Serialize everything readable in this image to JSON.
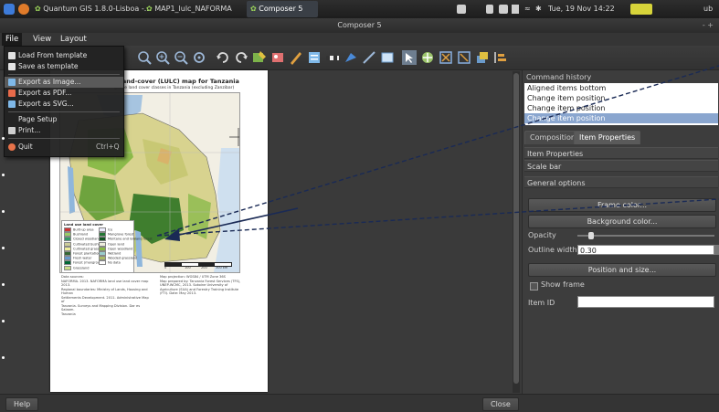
{
  "taskbar": {
    "items": [
      {
        "label": "Quantum GIS 1.8.0-Lisboa -..."
      },
      {
        "label": "MAP1_lulc_NAFORMA"
      },
      {
        "label": "Composer 5"
      }
    ],
    "clock": "Tue, 19 Nov 14:22",
    "user": "ub"
  },
  "window": {
    "title": "Composer 5",
    "controls": "- +"
  },
  "menubar": {
    "items": [
      "File",
      "View",
      "Layout"
    ]
  },
  "file_menu": {
    "items": [
      {
        "label": "Load From template",
        "icon": "folder-icon",
        "color": "#e3e3e3"
      },
      {
        "label": "Save as template",
        "icon": "save-icon",
        "color": "#e3e3e3"
      },
      {
        "label": "Export as Image...",
        "icon": "image-icon",
        "color": "#7fb8e8"
      },
      {
        "label": "Export as PDF...",
        "icon": "pdf-icon",
        "color": "#e86a4a"
      },
      {
        "label": "Export as SVG...",
        "icon": "svg-icon",
        "color": "#7fb8e8"
      },
      {
        "label": "Page Setup",
        "icon": "",
        "color": ""
      },
      {
        "label": "Print...",
        "icon": "printer-icon",
        "color": "#cfcfcf"
      },
      {
        "label": "Quit",
        "shortcut": "Ctrl+Q",
        "icon": "quit-icon",
        "color": "#e8734a"
      }
    ]
  },
  "page": {
    "title": "e land-cover (LULC) map for Tanzania",
    "subtitle": "gative land cover classes in Tanzania (excluding Zanzibar)",
    "legend_title": "Land use land cover",
    "legend": [
      {
        "label": "Built-up area",
        "color": "#c33"
      },
      {
        "label": "Bushland",
        "color": "#9c6"
      },
      {
        "label": "Closed woodland",
        "color": "#396"
      },
      {
        "label": "Cultivated bushland",
        "color": "#cc9"
      },
      {
        "label": "Cultivated grassland",
        "color": "#ee9"
      },
      {
        "label": "Forest plantation",
        "color": "#363"
      },
      {
        "label": "Fresh water",
        "color": "#69c"
      },
      {
        "label": "Forest (mangrove)",
        "color": "#063"
      },
      {
        "label": "Grassland",
        "color": "#cd8"
      },
      {
        "label": "Ice",
        "color": "#eef"
      },
      {
        "label": "Mangrove forest",
        "color": "#273"
      },
      {
        "label": "Montane and lowland forest",
        "color": "#152"
      },
      {
        "label": "Open land",
        "color": "#eed"
      },
      {
        "label": "Open woodland",
        "color": "#8b4"
      },
      {
        "label": "Wetland",
        "color": "#9cc"
      },
      {
        "label": "Wooded grassland",
        "color": "#ab6"
      },
      {
        "label": "No data",
        "color": "#fff"
      }
    ],
    "scale_labels": [
      "0",
      "100",
      "200",
      "300 km"
    ],
    "source_text": "Data sources:\nNAFORMA. 2013. NAFORMA land use land cover map 2013.\nRegional boundaries: Ministry of Lands, Housing and Human\nSettlements Development. 2011. Administrative Map of\nTanzania. Surveys and Mapping Division. Dar es Salaam.\nTanzania",
    "projection_text": "Map projection: WGS84 / UTM Zone 36S\nMap prepared by: Tanzania Forest Services (TFS),\nUNEP-WCMC, 2013. Sokoine University of\nAgriculture (SUA) and Forestry Training Institute\n(FTI). Date: May 2013."
  },
  "right_panel": {
    "history_header": "Command history",
    "history": [
      {
        "label": "Aligned items bottom",
        "selected": false
      },
      {
        "label": "Change item position",
        "selected": false
      },
      {
        "label": "Change item position",
        "selected": false
      },
      {
        "label": "Change item position",
        "selected": true
      }
    ],
    "tabs": [
      {
        "label": "Composition",
        "active": false
      },
      {
        "label": "Item Properties",
        "active": true
      }
    ],
    "item_properties_header": "Item Properties",
    "item_type": "Scale bar",
    "general_options": "General options",
    "frame_color_btn": "Frame color...",
    "background_color_btn": "Background color...",
    "opacity_label": "Opacity",
    "opacity_value": 0.1,
    "outline_width_label": "Outline width",
    "outline_width_value": "0.30",
    "position_size_btn": "Position and size...",
    "show_frame_label": "Show frame",
    "item_id_label": "Item ID",
    "item_id_value": ""
  },
  "bottom": {
    "help": "Help",
    "close": "Close"
  },
  "colors": {
    "arrow": "#1a2a55",
    "selected_row": "#8aa6cf"
  }
}
